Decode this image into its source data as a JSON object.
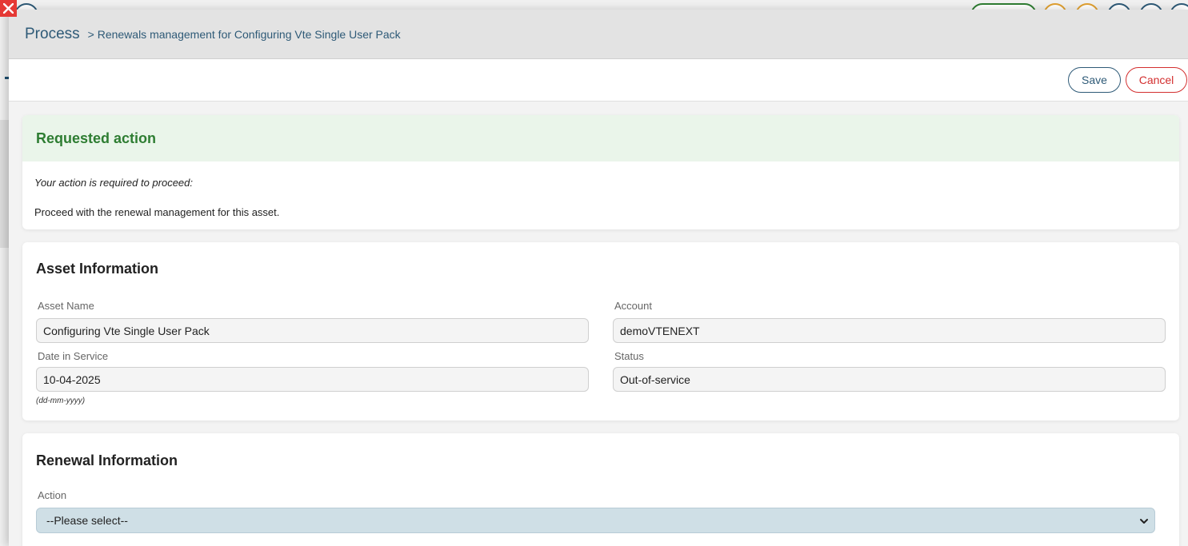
{
  "header": {
    "title": "Process",
    "breadcrumb": "> Renewals management for Configuring Vte Single User Pack"
  },
  "toolbar": {
    "save_label": "Save",
    "cancel_label": "Cancel"
  },
  "requested_action": {
    "title": "Requested action",
    "note": "Your action is required to proceed:",
    "text": "Proceed with the renewal management for this asset."
  },
  "asset_info": {
    "title": "Asset Information",
    "asset_name_label": "Asset Name",
    "asset_name_value": "Configuring Vte Single User Pack",
    "account_label": "Account",
    "account_value": "demoVTENEXT",
    "date_label": "Date in Service",
    "date_value": "10-04-2025",
    "date_hint": "(dd-mm-yyyy)",
    "status_label": "Status",
    "status_value": "Out-of-service"
  },
  "renewal_info": {
    "title": "Renewal Information",
    "action_label": "Action",
    "action_selected": "--Please select--"
  },
  "colors": {
    "accent": "#2e5a77",
    "success": "#2e7d32",
    "danger": "#d32f2f"
  },
  "icons": [
    "close-icon",
    "chevron-down-icon"
  ]
}
